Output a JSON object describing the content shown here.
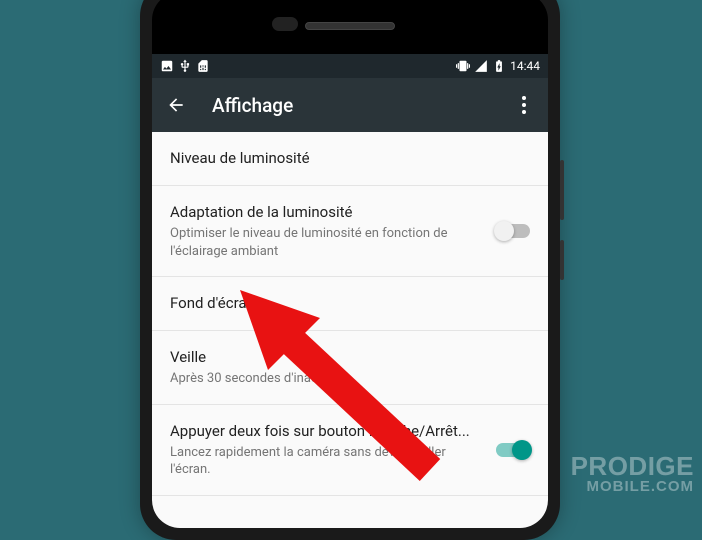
{
  "statusBar": {
    "time": "14:44"
  },
  "appBar": {
    "title": "Affichage"
  },
  "settings": {
    "brightness": {
      "title": "Niveau de luminosité"
    },
    "adaptive": {
      "title": "Adaptation de la luminosité",
      "subtitle": "Optimiser le niveau de luminosité en fonction de l'éclairage ambiant",
      "toggle": false
    },
    "wallpaper": {
      "title": "Fond d'écran"
    },
    "sleep": {
      "title": "Veille",
      "subtitle": "Après 30 secondes d'inactivité"
    },
    "doubleTap": {
      "title": "Appuyer deux fois sur bouton Marche/Arrêt...",
      "subtitle": "Lancez rapidement la caméra sans déverrouiller l'écran.",
      "toggle": true
    }
  },
  "watermark": {
    "line1": "PRODIGE",
    "line2": "MOBILE.COM"
  }
}
